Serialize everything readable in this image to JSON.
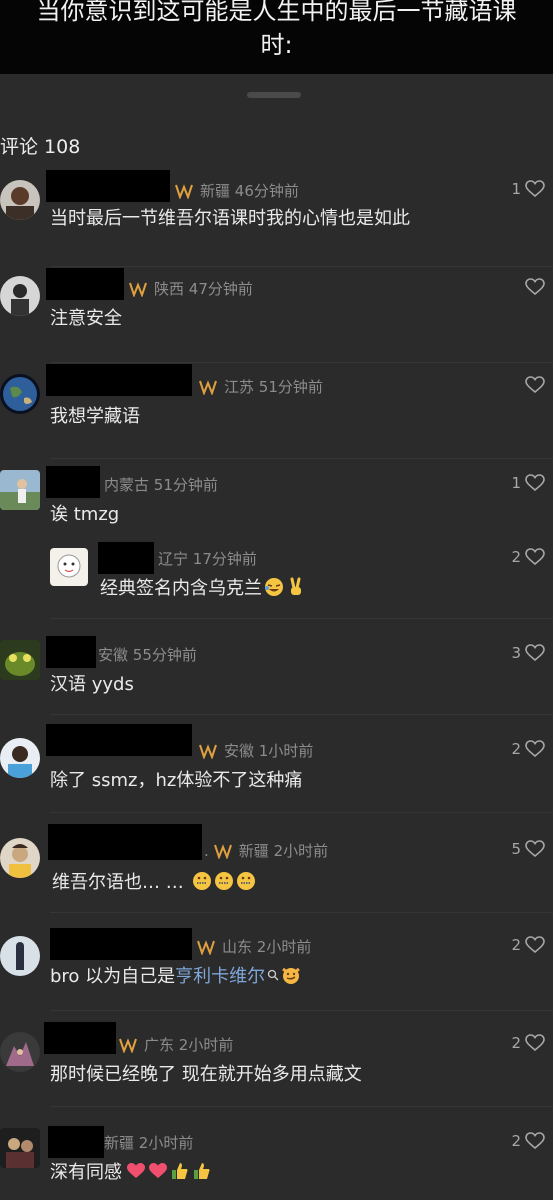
{
  "header": {
    "title": "当你意识到这可能是人生中的最后一节藏语课\n时:"
  },
  "comments_label": "评论 108",
  "comments": [
    {
      "location": "新疆",
      "time": "46分钟前",
      "text": "当时最后一节维吾尔语课时我的心情也是如此",
      "likes": "1",
      "badge": true
    },
    {
      "location": "陕西",
      "time": "47分钟前",
      "text": "注意安全",
      "likes": "",
      "badge": true
    },
    {
      "location": "江苏",
      "time": "51分钟前",
      "text": "我想学藏语",
      "likes": "",
      "badge": true
    },
    {
      "location": "内蒙古",
      "time": "51分钟前",
      "text": "诶 tmzg",
      "likes": "1",
      "badge": false
    },
    {
      "location": "辽宁",
      "time": "17分钟前",
      "text": "经典签名内含乌克兰",
      "likes": "2",
      "badge": false,
      "reply": true
    },
    {
      "location": "安徽",
      "time": "55分钟前",
      "text": "汉语 yyds",
      "likes": "3",
      "badge": false
    },
    {
      "location": "安徽",
      "time": "1小时前",
      "text": "除了 ssmz，hz体验不了这种痛",
      "likes": "2",
      "badge": true
    },
    {
      "location": "新疆",
      "time": "2小时前",
      "text": "维吾尔语也… …",
      "likes": "5",
      "badge": true
    },
    {
      "location": "山东",
      "time": "2小时前",
      "text_before": "bro 以为自己是 ",
      "text_link": "亨利卡维尔",
      "likes": "2",
      "badge": true
    },
    {
      "location": "广东",
      "time": "2小时前",
      "text": "那时候已经晚了 现在就开始多用点藏文",
      "likes": "2",
      "badge": true
    },
    {
      "location": "新疆",
      "time": "2小时前",
      "text": "深有同感",
      "likes": "2",
      "badge": false
    }
  ],
  "icons": {
    "heart": "heart-outline-icon",
    "badge": "fan-badge-icon",
    "search": "search-icon"
  },
  "colors": {
    "background": "#2b2b2b",
    "header": "#050505",
    "badge": "#e0a040",
    "link": "#7fa6d9"
  }
}
